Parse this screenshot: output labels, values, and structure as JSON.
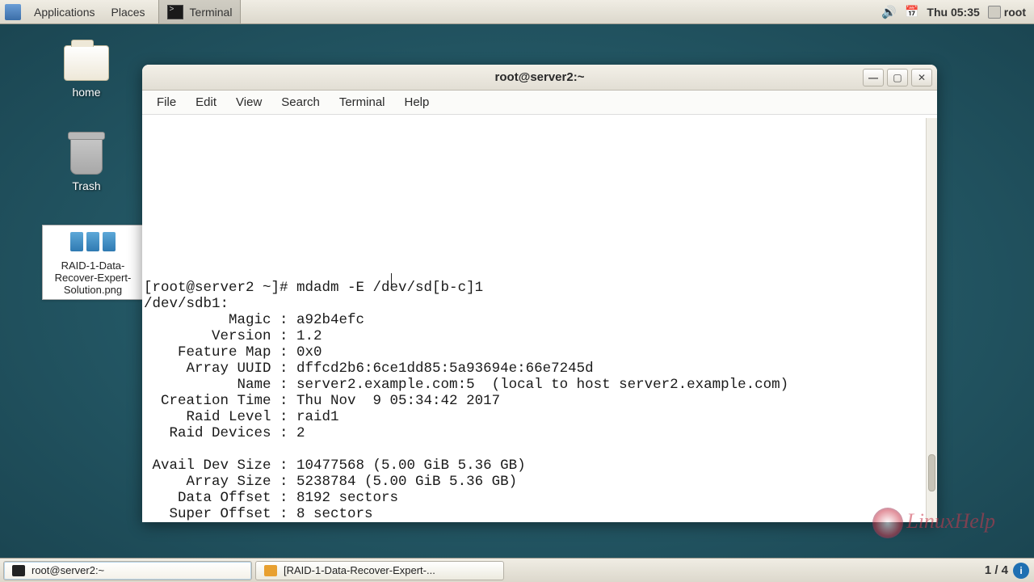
{
  "panel": {
    "applications": "Applications",
    "places": "Places",
    "terminal_launcher": "Terminal",
    "clock": "Thu 05:35",
    "user": "root"
  },
  "desktop": {
    "home_label": "home",
    "trash_label": "Trash",
    "raid_file_label": "RAID-1-Data-Recover-Expert-Solution.png"
  },
  "window": {
    "title": "root@server2:~",
    "menu": {
      "file": "File",
      "edit": "Edit",
      "view": "View",
      "search": "Search",
      "terminal": "Terminal",
      "help": "Help"
    }
  },
  "terminal": {
    "prompt": "[root@server2 ~]# mdadm -E /dev/sd[b-c]1",
    "lines": [
      "/dev/sdb1:",
      "          Magic : a92b4efc",
      "        Version : 1.2",
      "    Feature Map : 0x0",
      "     Array UUID : dffcd2b6:6ce1dd85:5a93694e:66e7245d",
      "           Name : server2.example.com:5  (local to host server2.example.com)",
      "  Creation Time : Thu Nov  9 05:34:42 2017",
      "     Raid Level : raid1",
      "   Raid Devices : 2",
      "",
      " Avail Dev Size : 10477568 (5.00 GiB 5.36 GB)",
      "     Array Size : 5238784 (5.00 GiB 5.36 GB)",
      "    Data Offset : 8192 sectors",
      "   Super Offset : 8 sectors"
    ]
  },
  "taskbar": {
    "task1": "root@server2:~",
    "task2": "[RAID-1-Data-Recover-Expert-...",
    "pager": "1 / 4"
  },
  "watermark": "LinuxHelp"
}
